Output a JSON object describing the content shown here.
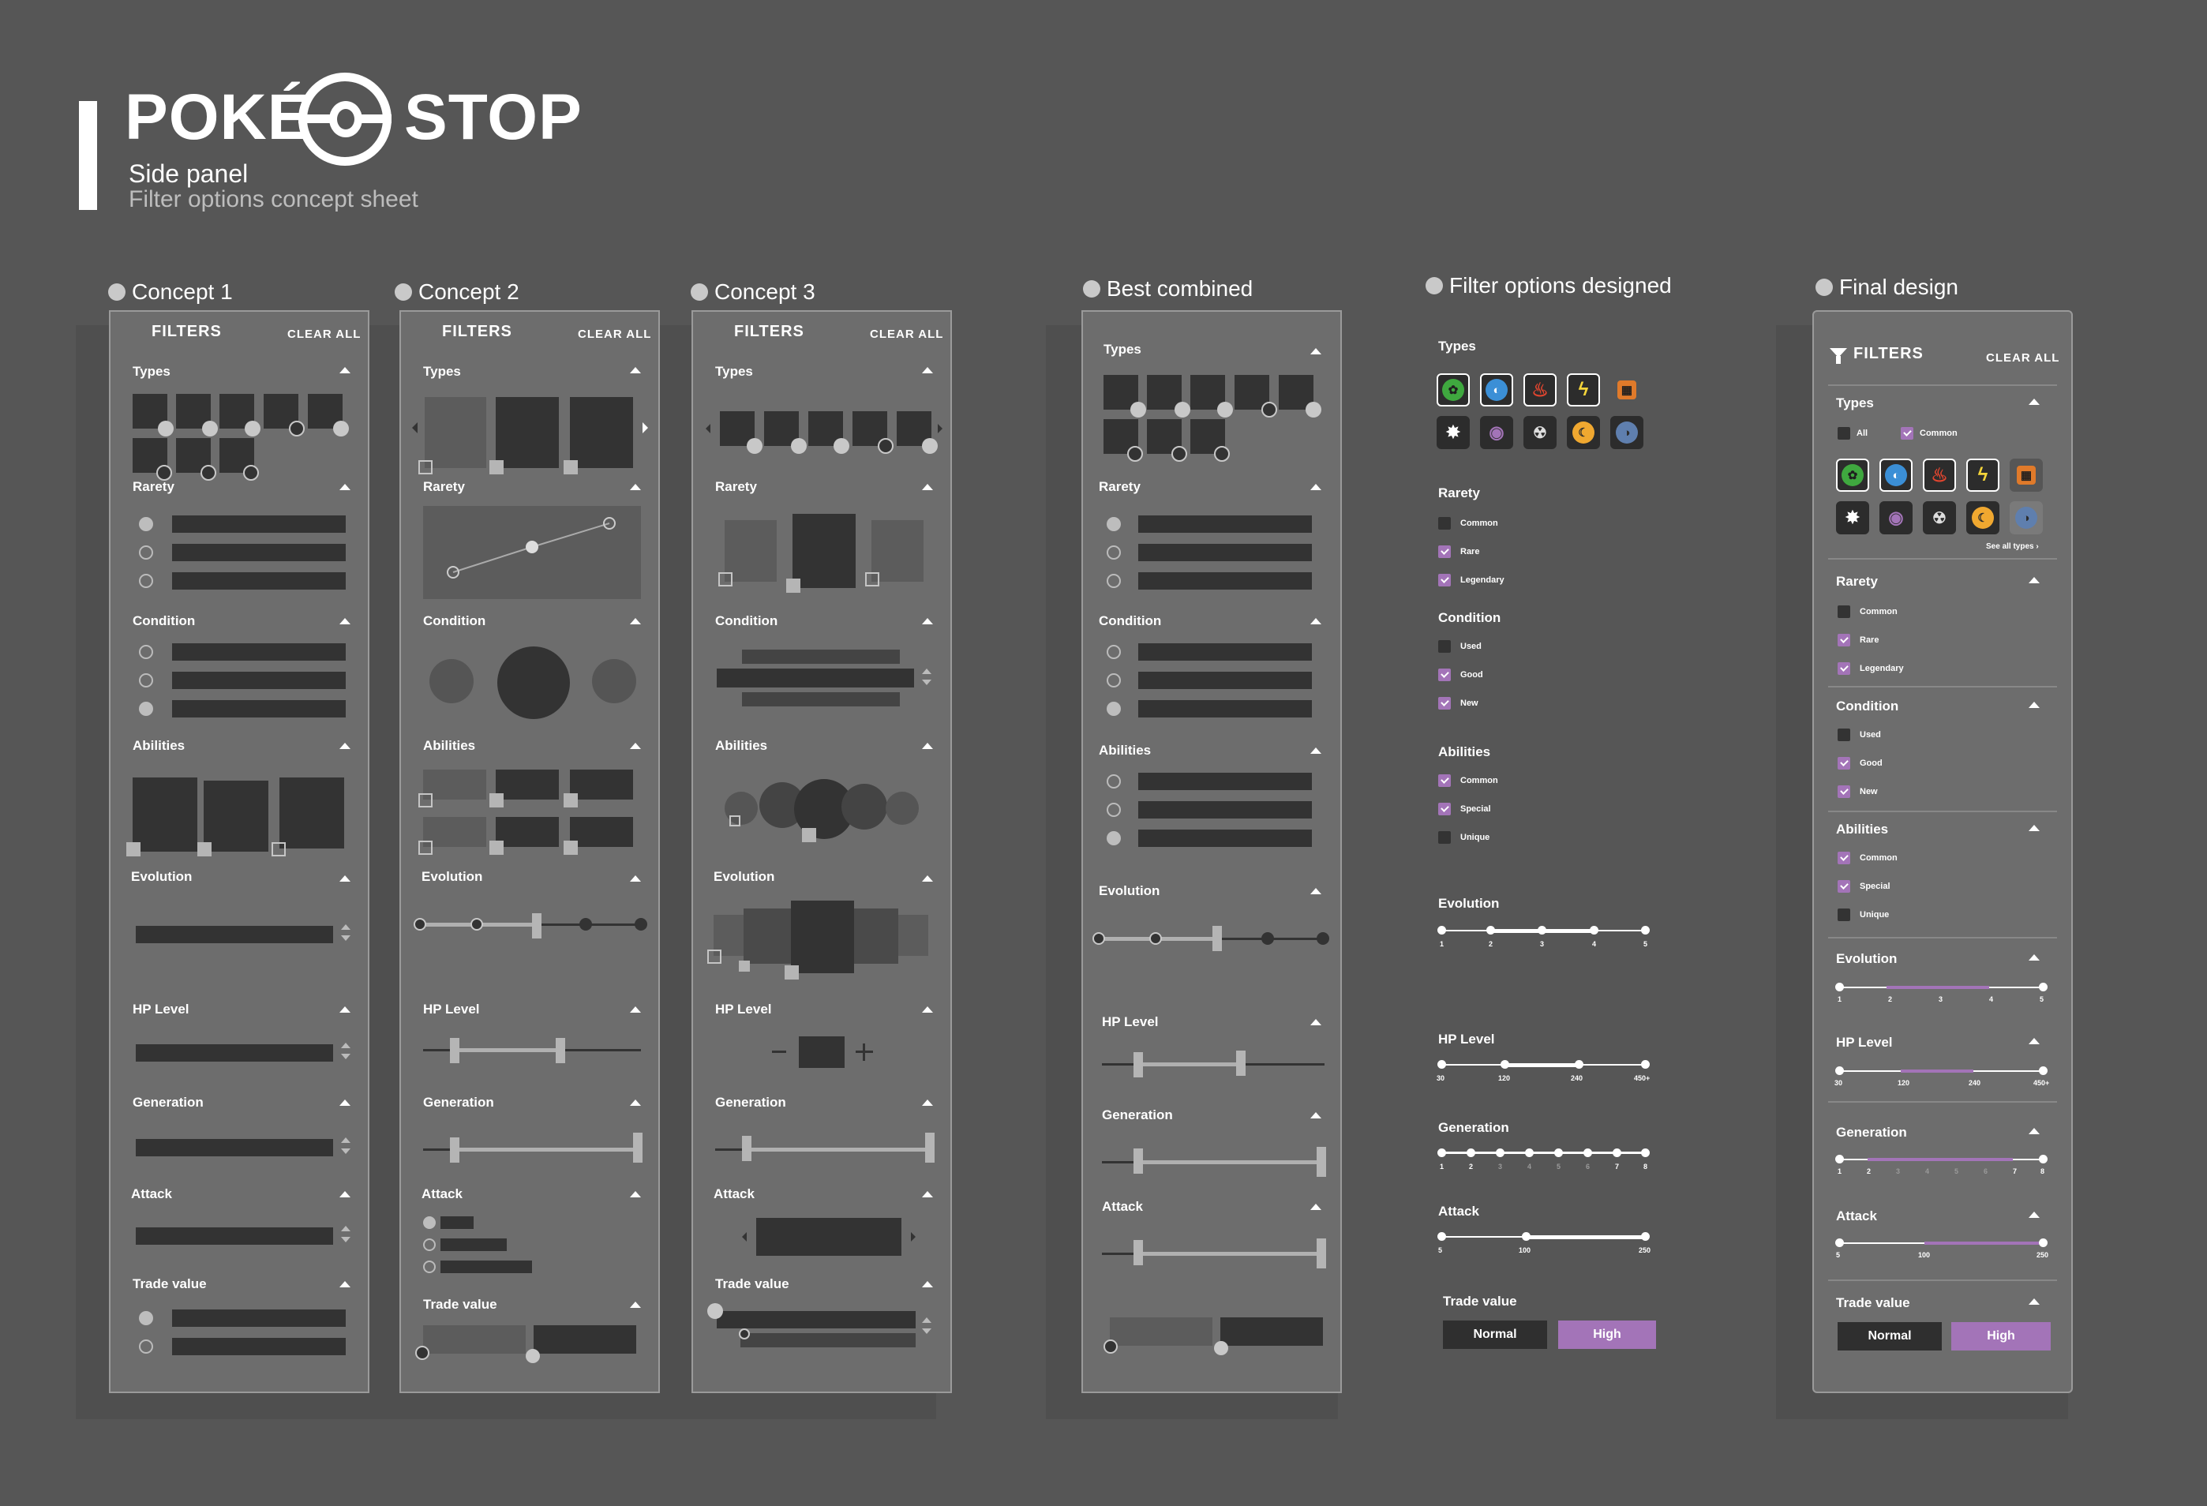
{
  "header": {
    "logo_left": "POKÉ",
    "logo_right": "STOP",
    "subtitle": "Side panel",
    "caption": "Filter options concept sheet"
  },
  "columns": {
    "c1": "Concept 1",
    "c2": "Concept 2",
    "c3": "Concept 3",
    "c4": "Best combined",
    "c5": "Filter options designed",
    "c6": "Final design"
  },
  "panel": {
    "filters": "FILTERS",
    "clear_all": "CLEAR ALL"
  },
  "sections": {
    "types": "Types",
    "rarety": "Rarety",
    "condition": "Condition",
    "abilities": "Abilities",
    "evolution": "Evolution",
    "hp": "HP Level",
    "generation": "Generation",
    "attack": "Attack",
    "trade": "Trade value"
  },
  "designed": {
    "rarety": [
      {
        "label": "Common",
        "checked": false
      },
      {
        "label": "Rare",
        "checked": true
      },
      {
        "label": "Legendary",
        "checked": true
      }
    ],
    "condition": [
      {
        "label": "Used",
        "checked": false
      },
      {
        "label": "Good",
        "checked": true
      },
      {
        "label": "New",
        "checked": true
      }
    ],
    "abilities": [
      {
        "label": "Common",
        "checked": true
      },
      {
        "label": "Special",
        "checked": true
      },
      {
        "label": "Unique",
        "checked": false
      }
    ],
    "evolution_ticks": [
      "1",
      "2",
      "3",
      "4",
      "5"
    ],
    "hp_ticks": [
      "30",
      "120",
      "240",
      "450+"
    ],
    "generation_ticks": [
      "1",
      "2",
      "3",
      "4",
      "5",
      "6",
      "7",
      "8"
    ],
    "attack_ticks": [
      "5",
      "100",
      "250"
    ],
    "trade_normal": "Normal",
    "trade_high": "High"
  },
  "final": {
    "types_all": "All",
    "types_common": "Common",
    "see_all": "See all types ›"
  },
  "colors": {
    "accent": "#a374b8",
    "bg": "#565656",
    "panel": "#6d6d6d"
  }
}
